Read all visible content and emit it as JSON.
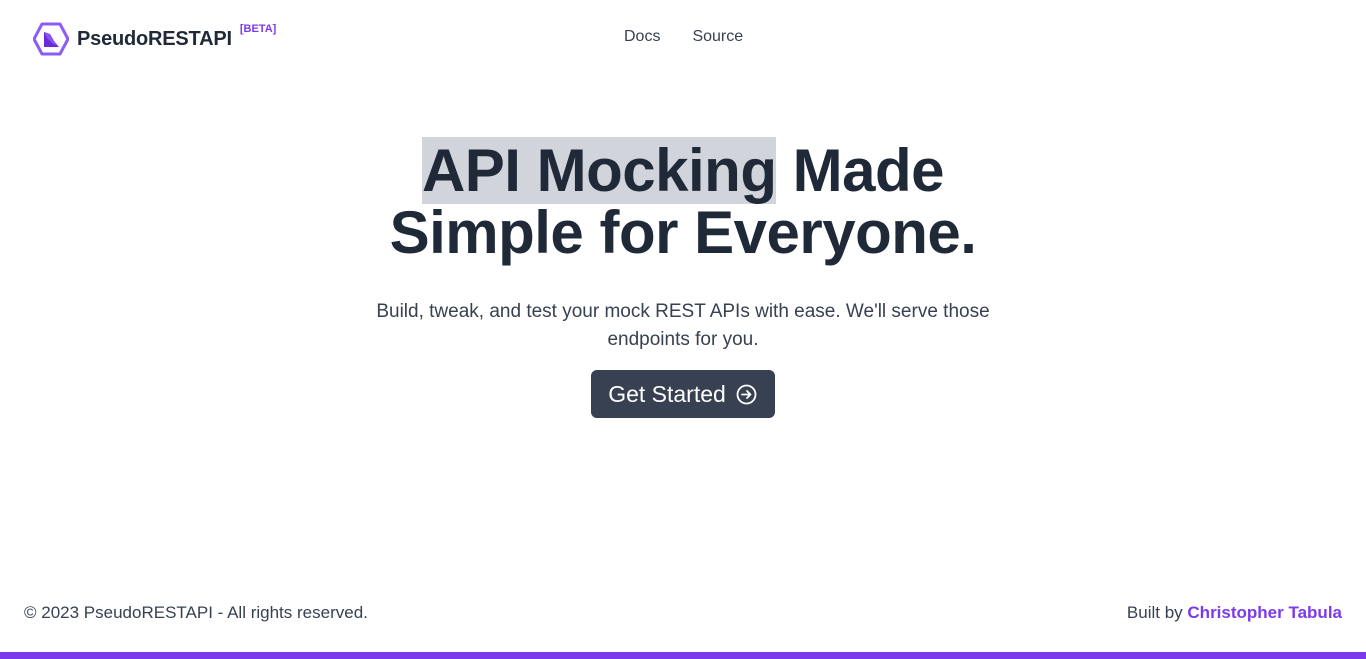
{
  "header": {
    "brand_name": "PseudoRESTAPI",
    "badge": "[BETA]",
    "logo_icon": "hexagon-logo-icon",
    "nav": [
      {
        "label": "Docs"
      },
      {
        "label": "Source"
      }
    ]
  },
  "hero": {
    "title_line1_selected": "API Mocking",
    "title_line1_rest": " Made",
    "title_line2": "Simple for Everyone.",
    "subtitle_line1": "Build, tweak, and test your mock REST APIs with ease. We'll serve those",
    "subtitle_line2": "endpoints for you.",
    "cta_label": "Get Started",
    "cta_icon": "arrow-right-circle-icon"
  },
  "footer": {
    "copyright": "© 2023 PseudoRESTAPI - All rights reserved.",
    "credit_prefix": "Built by ",
    "credit_name": "Christopher Tabula"
  },
  "colors": {
    "accent": "#7c3aed",
    "text_dark": "#1f2937",
    "button_bg": "#374151",
    "selection": "#d1d5db"
  }
}
